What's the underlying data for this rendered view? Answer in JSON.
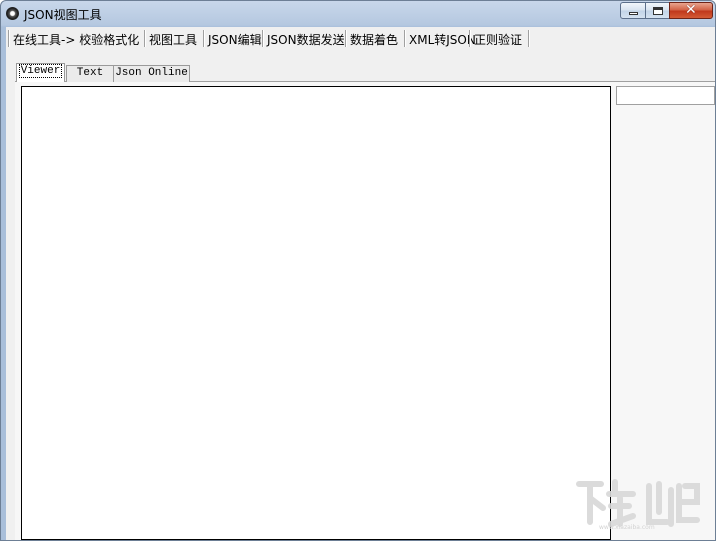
{
  "window": {
    "title": "JSON视图工具"
  },
  "menu": {
    "items": [
      {
        "label": "在线工具-> 校验格式化"
      },
      {
        "label": "视图工具"
      },
      {
        "label": "JSON编辑"
      },
      {
        "label": "JSON数据发送"
      },
      {
        "label": "数据着色"
      },
      {
        "label": "XML转JSON"
      },
      {
        "label": "正则验证"
      }
    ]
  },
  "tabs": [
    {
      "label": "Viewer",
      "active": true
    },
    {
      "label": "Text",
      "active": false
    },
    {
      "label": "Json Online",
      "active": false
    }
  ],
  "viewer": {
    "content": ""
  },
  "side_input": {
    "value": ""
  },
  "watermark": {
    "icon": "download-site-watermark",
    "text": "下载吧"
  }
}
